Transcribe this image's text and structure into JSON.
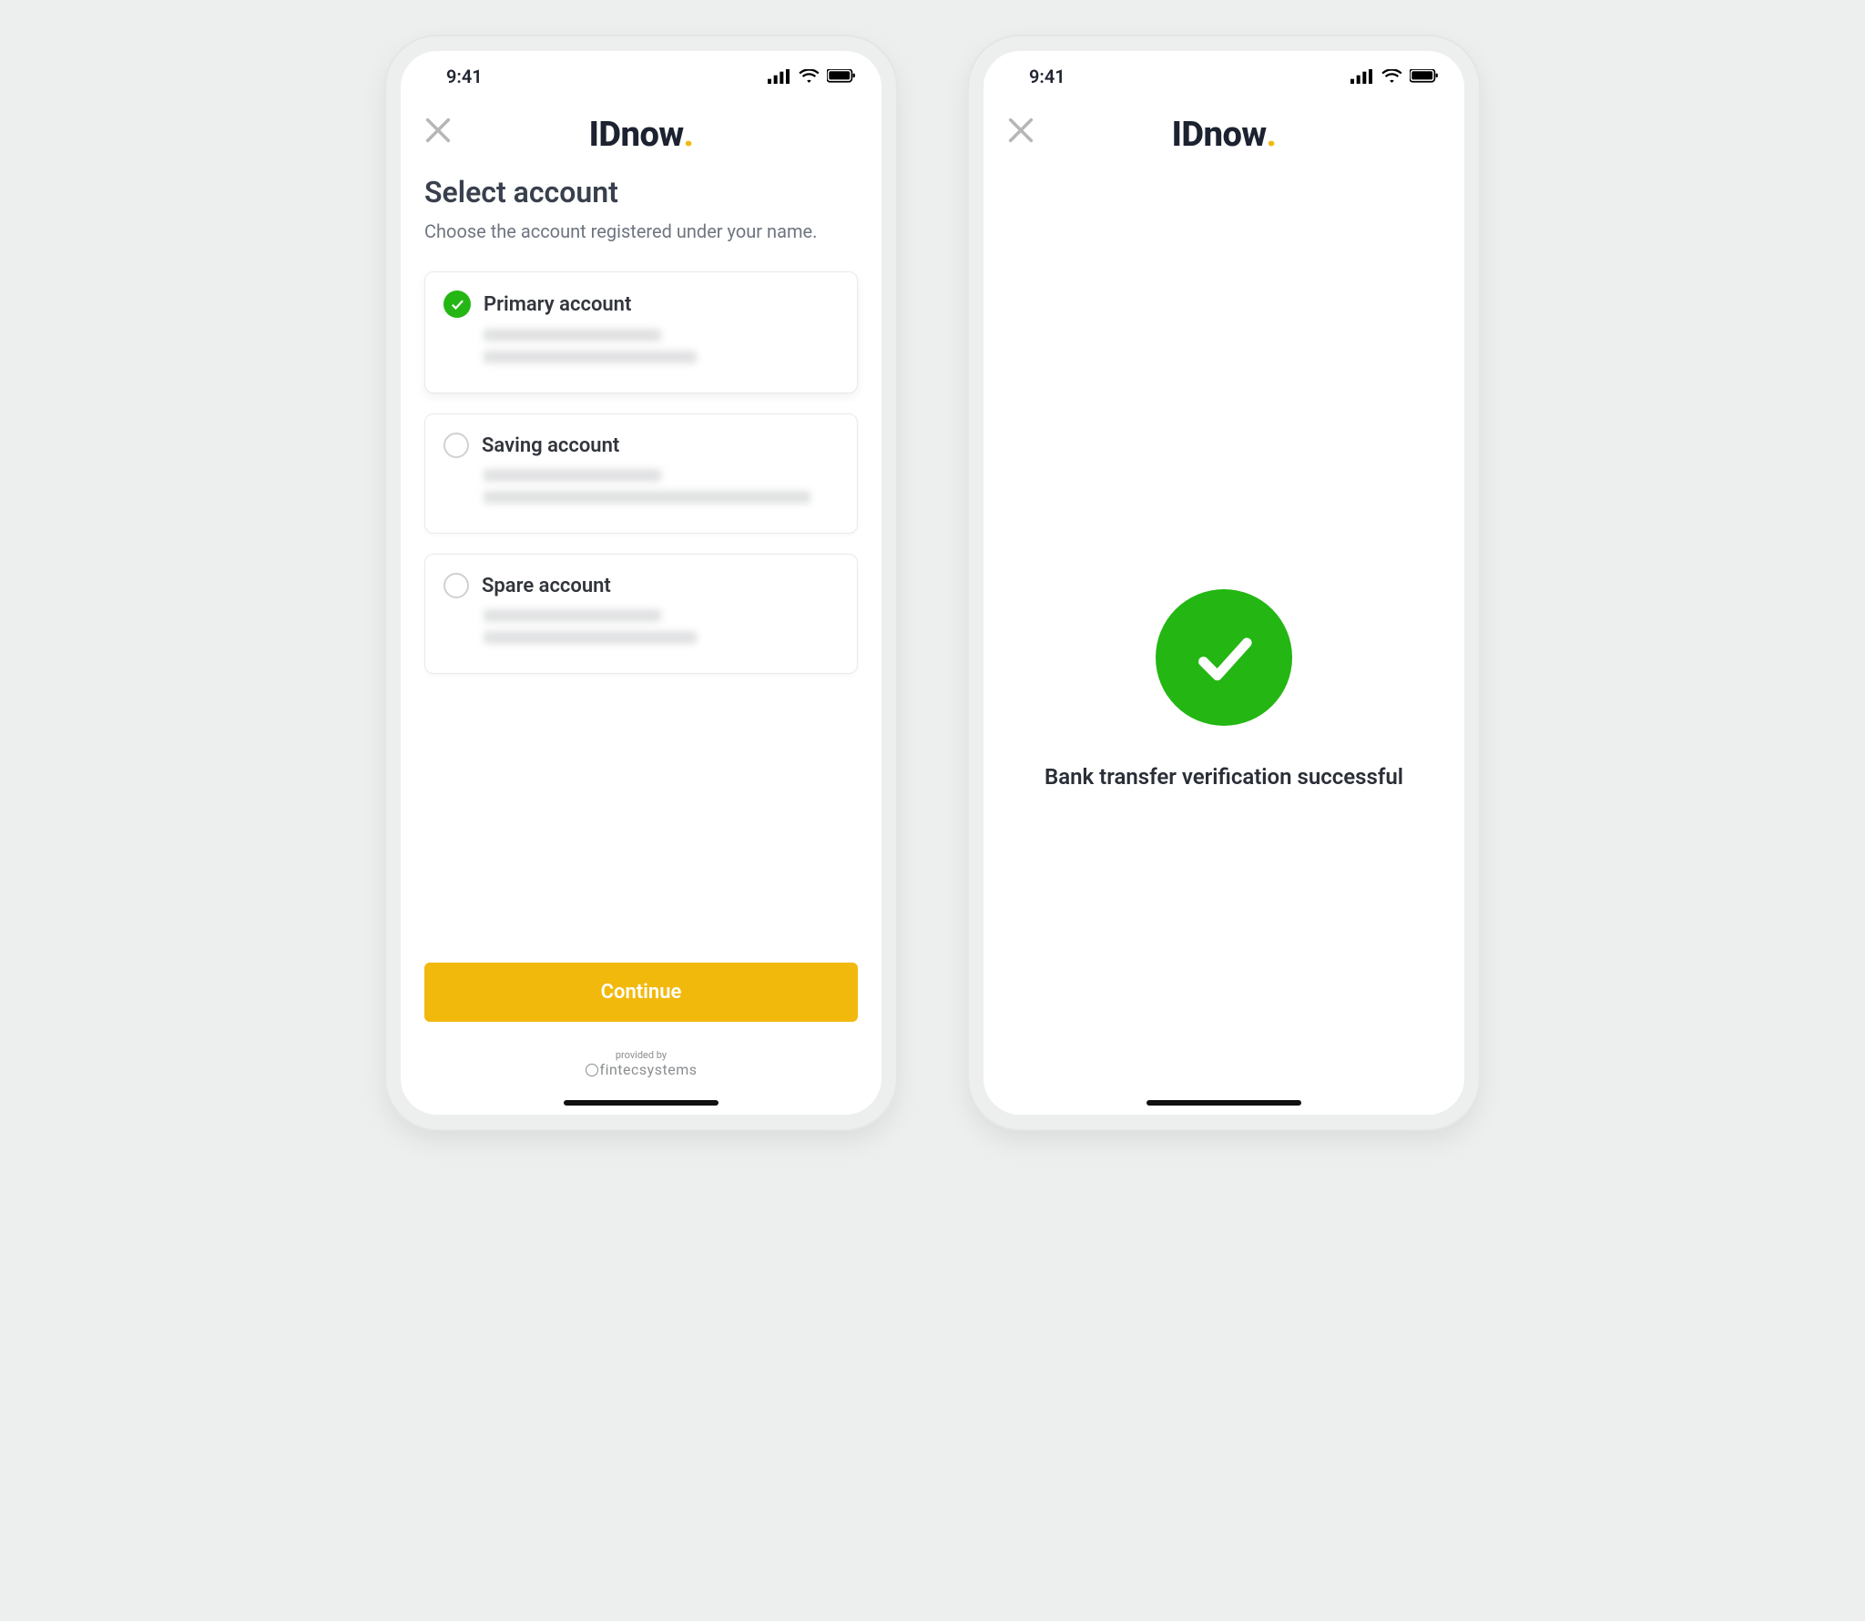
{
  "status": {
    "time": "9:41"
  },
  "brand": {
    "name": "IDnow"
  },
  "select": {
    "title": "Select account",
    "subtitle": "Choose the account registered under your name.",
    "accounts": [
      {
        "label": "Primary account",
        "selected": true
      },
      {
        "label": "Saving account",
        "selected": false
      },
      {
        "label": "Spare account",
        "selected": false
      }
    ],
    "continue_label": "Continue",
    "footer": {
      "provided": "provided by",
      "company": "fintecsystems"
    }
  },
  "success": {
    "message": "Bank transfer verification successful"
  },
  "colors": {
    "accent": "#f2b90d",
    "success": "#24b613",
    "text": "#1f2430",
    "muted": "#6e7580"
  }
}
